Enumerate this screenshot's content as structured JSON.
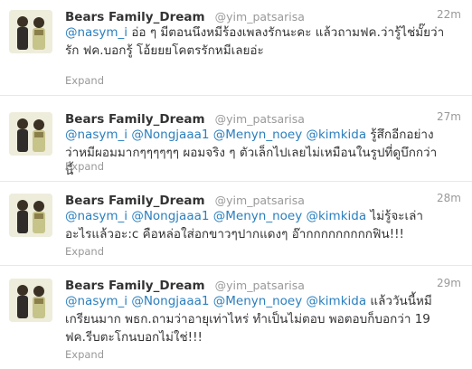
{
  "tweets": [
    {
      "fullname": "Bears Family_Dream",
      "username": "@yim_patsarisa",
      "time": "22m",
      "mentions": [
        "@nasym_i"
      ],
      "body": "อ่อ ๆ มีตอนนึงหมีร้องเพลงรักนะคะ แล้วถามฟค.ว่ารู้ไช่มั๊ยว่ารัก ฟค.บอกรู้ โอ้ยยยโคตรรักหมีเลยอ่ะ",
      "expand": "Expand"
    },
    {
      "fullname": "Bears Family_Dream",
      "username": "@yim_patsarisa",
      "time": "27m",
      "mentions": [
        "@nasym_i",
        "@Nongjaaa1",
        "@Menyn_noey",
        "@kimkida"
      ],
      "body": "รู้สึกอีกอย่างว่าหมีผอมมากๆๆๆๆๆๆ ผอมจริง ๆ ตัวเล็กไปเลยไม่เหมือนในรูปที่ดูบึกกว่านี้",
      "expand": "Expand"
    },
    {
      "fullname": "Bears Family_Dream",
      "username": "@yim_patsarisa",
      "time": "28m",
      "mentions": [
        "@nasym_i",
        "@Nongjaaa1",
        "@Menyn_noey",
        "@kimkida"
      ],
      "body": "ไม่รู้จะเล่าอะไรแล้วอะ:c คือหล่อใส่อกขาวๆปากแดงๆ อ๊ากกกกกกกกกฟิน!!!",
      "expand": "Expand"
    },
    {
      "fullname": "Bears Family_Dream",
      "username": "@yim_patsarisa",
      "time": "29m",
      "mentions": [
        "@nasym_i",
        "@Nongjaaa1",
        "@Menyn_noey",
        "@kimkida"
      ],
      "body": "แล้ววันนี้หมีเกรียนมาก พธก.ถามว่าอายุเท่าไหร่ ทำเป็นไม่ตอบ พอตอบก็บอกว่า 19 ฟค.รีบตะโกนบอกไม่ใช่!!!",
      "expand": "Expand"
    }
  ]
}
